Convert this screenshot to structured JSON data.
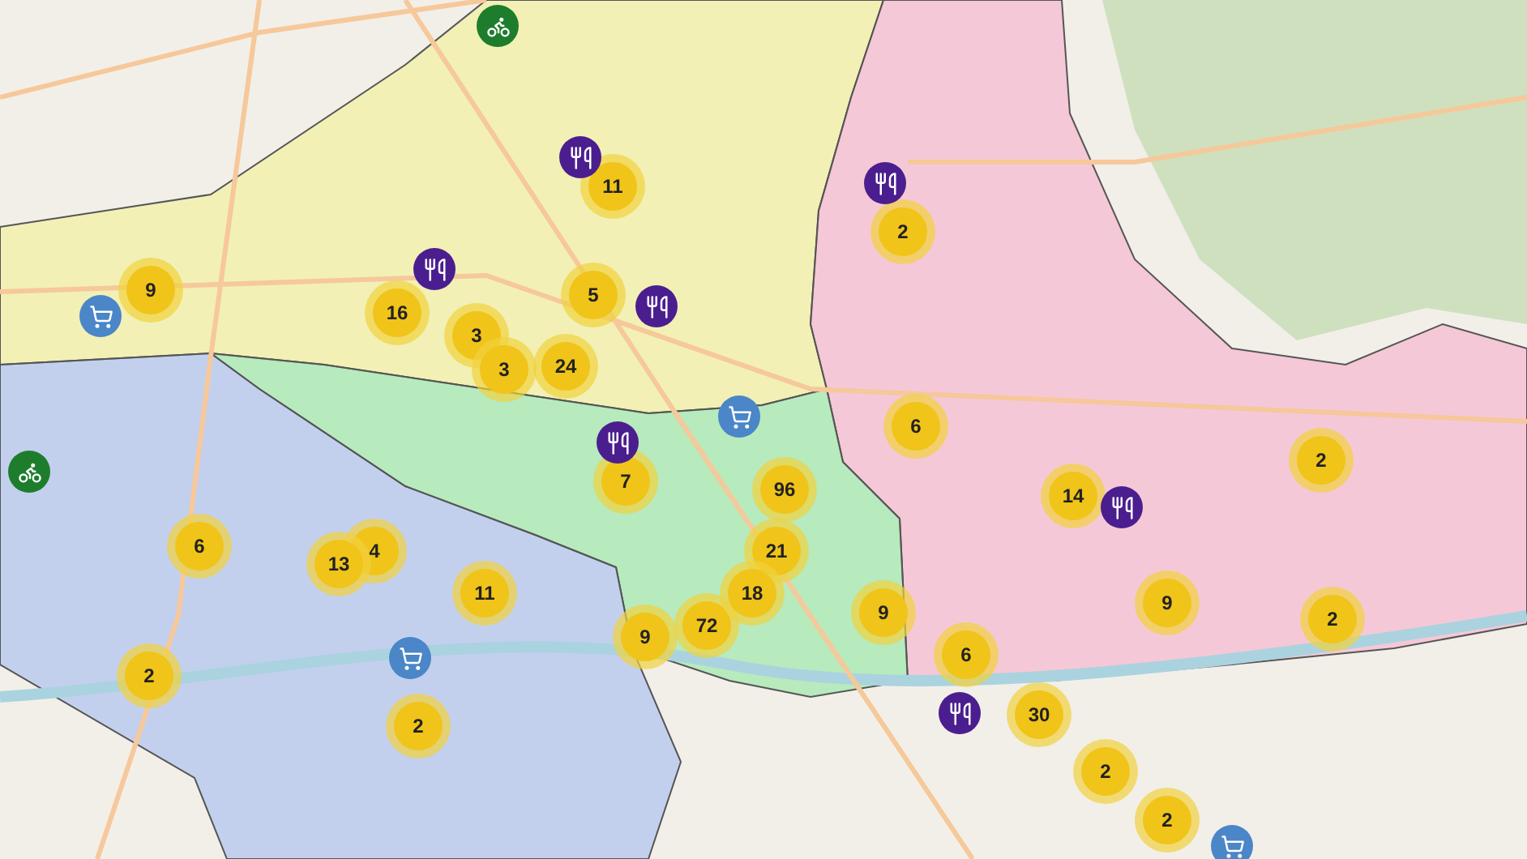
{
  "clusters": [
    {
      "count": "11"
    },
    {
      "count": "2"
    },
    {
      "count": "9"
    },
    {
      "count": "16"
    },
    {
      "count": "5"
    },
    {
      "count": "3"
    },
    {
      "count": "3"
    },
    {
      "count": "24"
    },
    {
      "count": "6"
    },
    {
      "count": "7"
    },
    {
      "count": "96"
    },
    {
      "count": "14"
    },
    {
      "count": "2"
    },
    {
      "count": "6"
    },
    {
      "count": "4"
    },
    {
      "count": "13"
    },
    {
      "count": "21"
    },
    {
      "count": "11"
    },
    {
      "count": "9"
    },
    {
      "count": "72"
    },
    {
      "count": "18"
    },
    {
      "count": "9"
    },
    {
      "count": "9"
    },
    {
      "count": "2"
    },
    {
      "count": "2"
    },
    {
      "count": "6"
    },
    {
      "count": "30"
    },
    {
      "count": "2"
    },
    {
      "count": "2"
    },
    {
      "count": "2"
    }
  ],
  "poi_markers": [
    {
      "kind": "restaurant"
    },
    {
      "kind": "restaurant"
    },
    {
      "kind": "restaurant"
    },
    {
      "kind": "restaurant"
    },
    {
      "kind": "restaurant"
    },
    {
      "kind": "restaurant"
    },
    {
      "kind": "restaurant"
    },
    {
      "kind": "shop"
    },
    {
      "kind": "shop"
    },
    {
      "kind": "shop"
    },
    {
      "kind": "shop"
    },
    {
      "kind": "scooter"
    },
    {
      "kind": "scooter"
    }
  ]
}
